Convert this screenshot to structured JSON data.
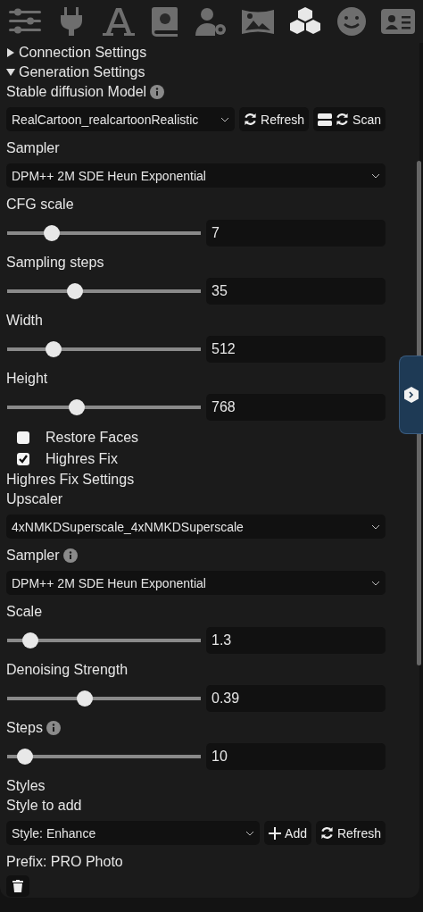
{
  "toolbar": [
    {
      "selected": false
    },
    {
      "selected": false
    },
    {
      "selected": false
    },
    {
      "selected": false
    },
    {
      "selected": false
    },
    {
      "selected": false
    },
    {
      "selected": true
    },
    {
      "selected": false
    },
    {
      "selected": false
    }
  ],
  "items": [
    {
      "kind": "collapsible",
      "label": "Connection Settings",
      "expanded": false
    },
    {
      "kind": "collapsible",
      "label": "Generation Settings",
      "expanded": true
    },
    {
      "kind": "label",
      "text": "Stable diffusion Model",
      "info": true
    },
    {
      "kind": "select",
      "value": "RealCartoon_realcartoonRealistic",
      "buttons": [
        {
          "kind": "refresh",
          "label": "Refresh"
        },
        {
          "kind": "scan",
          "label": "Scan"
        }
      ]
    },
    {
      "kind": "label",
      "text": "Sampler"
    },
    {
      "kind": "select",
      "value": "DPM++ 2M SDE Heun Exponential"
    },
    {
      "kind": "slider",
      "label": "CFG scale",
      "value": "7",
      "level": 0.23
    },
    {
      "kind": "slider",
      "label": "Sampling steps",
      "value": "35",
      "level": 0.35
    },
    {
      "kind": "slider",
      "label": "Width",
      "value": "512",
      "level": 0.24
    },
    {
      "kind": "slider",
      "label": "Height",
      "value": "768",
      "level": 0.36
    },
    {
      "kind": "checkbox",
      "label": "Restore Faces",
      "checked": false
    },
    {
      "kind": "checkbox",
      "label": "Highres Fix",
      "checked": true
    },
    {
      "kind": "label",
      "text": "Highres Fix Settings"
    },
    {
      "kind": "label",
      "text": "Upscaler"
    },
    {
      "kind": "select",
      "value": "4xNMKDSuperscale_4xNMKDSuperscale"
    },
    {
      "kind": "label",
      "text": "Sampler",
      "info": true
    },
    {
      "kind": "select",
      "value": "DPM++ 2M SDE Heun Exponential"
    },
    {
      "kind": "slider",
      "label": "Scale",
      "value": "1.3",
      "level": 0.12
    },
    {
      "kind": "slider",
      "label": "Denoising Strength",
      "value": "0.39",
      "level": 0.4
    },
    {
      "kind": "slider",
      "label": "Steps",
      "value": "10",
      "level": 0.09,
      "info": true
    },
    {
      "kind": "label",
      "text": "Styles"
    },
    {
      "kind": "label",
      "text": "Style to add"
    },
    {
      "kind": "select",
      "value": "Style: Enhance",
      "buttons": [
        {
          "kind": "add",
          "label": "Add"
        },
        {
          "kind": "refresh",
          "label": "Refresh"
        }
      ]
    },
    {
      "kind": "label",
      "text": "Prefix: PRO Photo"
    },
    {
      "kind": "trash"
    }
  ]
}
